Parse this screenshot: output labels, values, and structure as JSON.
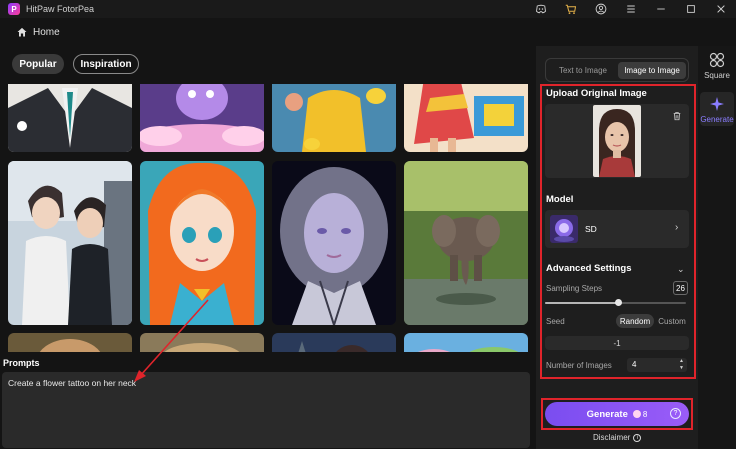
{
  "app": {
    "title": "HitPaw FotorPea",
    "logo_letter": "P"
  },
  "titlebar": {
    "icons": [
      "discord-icon",
      "cart-icon",
      "account-icon",
      "menu-icon",
      "minimize-icon",
      "maximize-icon",
      "close-icon"
    ]
  },
  "nav": {
    "home_label": "Home"
  },
  "filters": {
    "popular": "Popular",
    "inspiration": "Inspiration"
  },
  "gallery": {
    "tiles": [
      "suit",
      "pink-monster",
      "yellow-duck-coat",
      "colorful-dress",
      "anime-boys",
      "anime-girl",
      "silver-woman",
      "elephant",
      "bottom-1",
      "bottom-2",
      "bottom-3",
      "bottom-4"
    ]
  },
  "prompts": {
    "label": "Prompts",
    "value": "Create a flower tattoo on her neck"
  },
  "mode": {
    "text_to_image": "Text to Image",
    "image_to_image": "Image to Image",
    "selected": "Image to Image"
  },
  "upload": {
    "title": "Upload Original Image"
  },
  "model": {
    "title": "Model",
    "name": "SD"
  },
  "advanced": {
    "title": "Advanced Settings",
    "sampling_steps_label": "Sampling Steps",
    "sampling_steps_value": "26",
    "sampling_steps_fraction": 0.52,
    "seed_label": "Seed",
    "seed_random": "Random",
    "seed_custom": "Custom",
    "seed_value": "-1",
    "num_images_label": "Number of Images",
    "num_images_value": "4"
  },
  "generate": {
    "label": "Generate",
    "credits": "8",
    "help": "?"
  },
  "disclaimer": {
    "label": "Disclaimer",
    "info": "i"
  },
  "rail": {
    "square_label": "Square",
    "generate_label": "Generate"
  },
  "colors": {
    "accent": "#8a5cf6",
    "highlight_box": "#e0242b",
    "annotation_arrow": "#e0242b"
  }
}
